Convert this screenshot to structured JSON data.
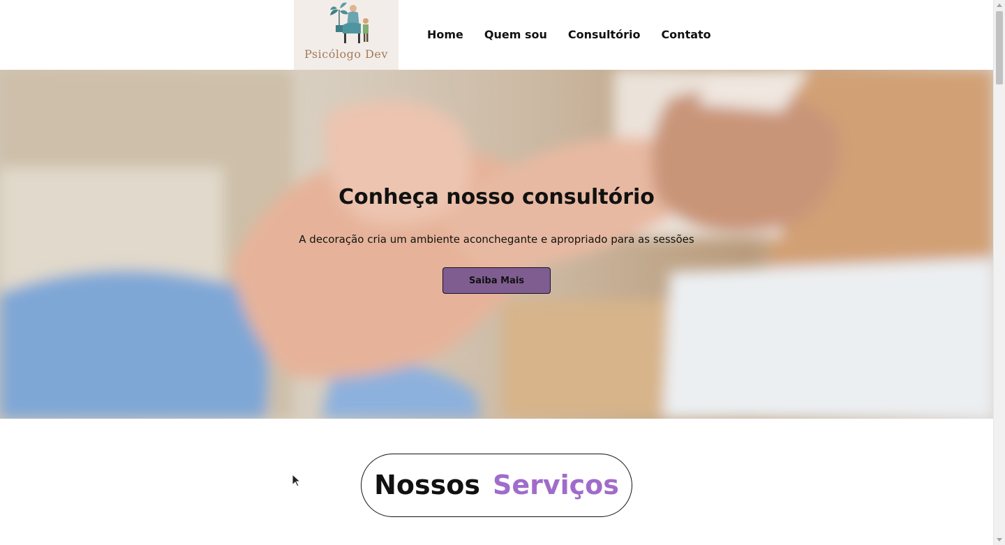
{
  "header": {
    "logo_text": "Psicólogo Dev",
    "nav": [
      {
        "label": "Home"
      },
      {
        "label": "Quem sou"
      },
      {
        "label": "Consultório"
      },
      {
        "label": "Contato"
      }
    ]
  },
  "hero": {
    "title": "Conheça nosso consultório",
    "subtitle": "A decoração cria um ambiente aconchegante e apropriado para as sessões",
    "button_label": "Saiba Mais",
    "button_color": "#7f5d90"
  },
  "services": {
    "word1": "Nossos",
    "word2": "Serviços",
    "accent_color": "#a06ccb"
  }
}
